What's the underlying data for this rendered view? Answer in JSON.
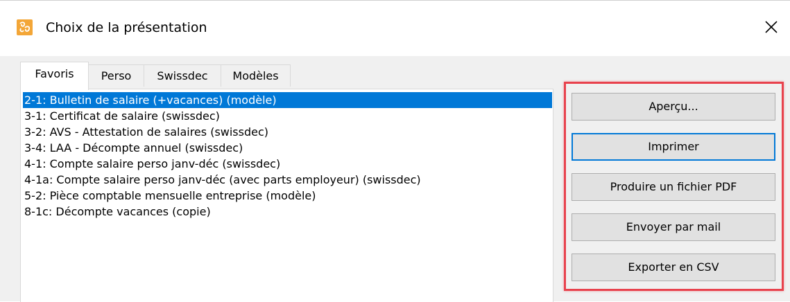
{
  "window": {
    "title": "Choix de la présentation",
    "app_icon": "banana-app-icon",
    "close_icon": "close-icon"
  },
  "tabs": [
    {
      "label": "Favoris",
      "active": true
    },
    {
      "label": "Perso",
      "active": false
    },
    {
      "label": "Swissdec",
      "active": false
    },
    {
      "label": "Modèles",
      "active": false
    }
  ],
  "list": {
    "selected_index": 0,
    "items": [
      "2-1: Bulletin de salaire (+vacances) (modèle)",
      "3-1: Certificat de salaire (swissdec)",
      "3-2: AVS - Attestation de salaires (swissdec)",
      "3-4: LAA - Décompte annuel (swissdec)",
      "4-1: Compte salaire perso janv-déc (swissdec)",
      "4-1a: Compte salaire perso janv-déc (avec parts employeur) (swissdec)",
      "5-2: Pièce comptable mensuelle entreprise (modèle)",
      "8-1c: Décompte vacances (copie)"
    ]
  },
  "actions": {
    "apercu": "Aperçu...",
    "imprimer": "Imprimer",
    "pdf": "Produire un fichier PDF",
    "mail": "Envoyer par mail",
    "csv": "Exporter en CSV"
  },
  "colors": {
    "selection": "#0078d7",
    "highlight_border": "#e8424d",
    "app_icon_bg": "#f3a637"
  }
}
